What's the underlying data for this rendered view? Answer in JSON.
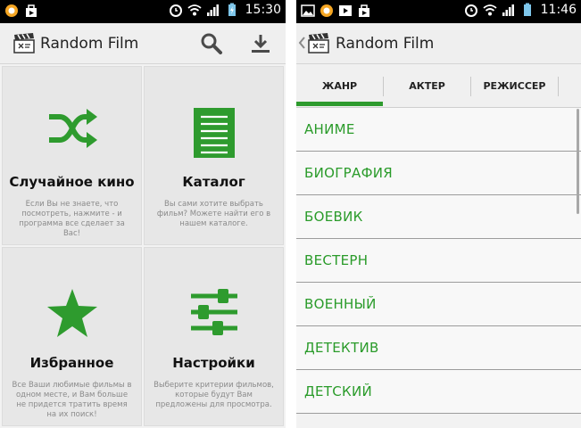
{
  "colors": {
    "accent_green": "#2e9b2e",
    "statusbar": "#000000",
    "actionbar": "#efefef"
  },
  "left_screen": {
    "statusbar": {
      "icons": [
        "notification-circle-icon",
        "bag-icon",
        "alarm-icon",
        "wifi-icon",
        "signal-icon",
        "battery-charging-icon"
      ],
      "clock": "15:30"
    },
    "actionbar": {
      "title": "Random Film",
      "icons": [
        "search-icon",
        "download-icon"
      ]
    },
    "tiles": [
      {
        "title": "Случайное кино",
        "desc": "Если Вы не знаете, что посмотреть, нажмите - и программа все сделает за Вас!",
        "icon": "shuffle-icon"
      },
      {
        "title": "Каталог",
        "desc": "Вы сами хотите выбрать фильм? Можете найти его в нашем каталоге.",
        "icon": "list-icon"
      },
      {
        "title": "Избранное",
        "desc": "Все Ваши любимые фильмы в одном месте, и Вам больше не придется тратить время на их поиск!",
        "icon": "star-icon"
      },
      {
        "title": "Настройки",
        "desc": "Выберите критерии фильмов, которые будут Вам предложены для просмотра.",
        "icon": "sliders-icon"
      }
    ]
  },
  "right_screen": {
    "statusbar": {
      "icons": [
        "image-icon",
        "notification-circle-icon",
        "play-icon",
        "bag-icon",
        "alarm-icon",
        "wifi-icon",
        "signal-icon",
        "battery-icon"
      ],
      "clock": "11:46"
    },
    "actionbar": {
      "title": "Random Film"
    },
    "tabs": [
      {
        "label": "ЖАНР",
        "selected": true
      },
      {
        "label": "АКТЕР",
        "selected": false
      },
      {
        "label": "РЕЖИССЕР",
        "selected": false
      }
    ],
    "genres": [
      "АНИМЕ",
      "БИОГРАФИЯ",
      "БОЕВИК",
      "ВЕСТЕРН",
      "ВОЕННЫЙ",
      "ДЕТЕКТИВ",
      "ДЕТСКИЙ"
    ]
  }
}
